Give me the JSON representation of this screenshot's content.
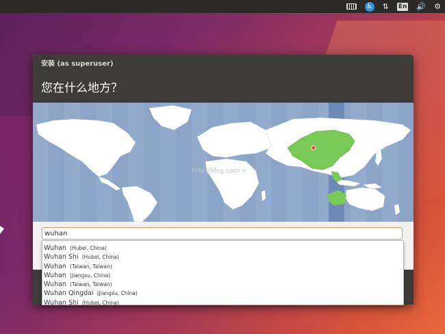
{
  "top_panel": {
    "icons": [
      "keyboard-icon",
      "accessibility-icon",
      "network-icon",
      "language-indicator",
      "volume-icon",
      "settings-gear-icon"
    ],
    "language_label": "En"
  },
  "window": {
    "title": "安装 (as superuser)",
    "heading": "您在什么地方？"
  },
  "map": {
    "watermark": "http://blog.csdn.n",
    "ocean_color": "#8ba4c7",
    "land_color": "#ffffff",
    "selected_region_color": "#79c956",
    "selected_timezone_band_color": "#6d89b6",
    "location_marker_color": "#e0514b"
  },
  "search": {
    "value": "wuhan"
  },
  "suggestions": [
    {
      "name": "Wuhan",
      "region": "(Hubei, China)"
    },
    {
      "name": "Wuhan Shi",
      "region": "(Hubei, China)"
    },
    {
      "name": "Wuhan",
      "region": "(Taiwan, Taiwan)"
    },
    {
      "name": "Wuhan",
      "region": "(Jiangsu, China)"
    },
    {
      "name": "Wuhan",
      "region": "(Taiwan, Taiwan)"
    },
    {
      "name": "Wuhan Qingdai",
      "region": "(Jiangsu, China)"
    },
    {
      "name": "Wuhan Shi",
      "region": "(Hubei, China)"
    }
  ]
}
